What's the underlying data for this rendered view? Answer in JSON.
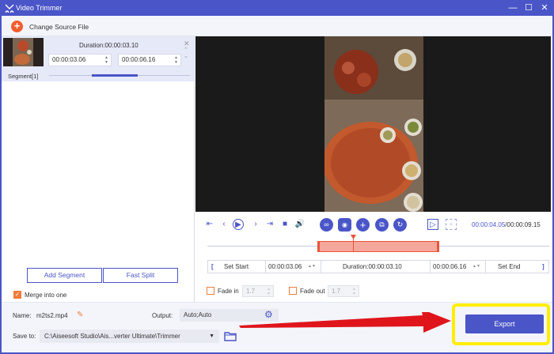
{
  "window": {
    "title": "Video Trimmer",
    "controls": [
      "minimize-icon",
      "maximize-icon",
      "close-icon"
    ]
  },
  "toolbar": {
    "change_source": "Change Source File"
  },
  "segment": {
    "duration_label": "Duration:00:00:03.10",
    "start": "00:00:03.06",
    "end": "00:00:06.16",
    "label": "Segment[1]"
  },
  "left_buttons": {
    "add_segment": "Add Segment",
    "fast_split": "Fast Split"
  },
  "merge": {
    "label": "Merge into one",
    "checked": true
  },
  "player": {
    "current_time": "00:00:04.05",
    "total_time": "/00:00:09.15"
  },
  "trim": {
    "set_start": "Set Start",
    "start_value": "00:00:03.06",
    "duration": "Duration:00:00:03.10",
    "end_value": "00:00:06.16",
    "set_end": "Set End"
  },
  "fade": {
    "fade_in_label": "Fade in",
    "fade_in_value": "1.7",
    "fade_out_label": "Fade out",
    "fade_out_value": "1.7"
  },
  "output": {
    "name_label": "Name:",
    "name_value": "m2ts2.mp4",
    "output_label": "Output:",
    "output_value": "Auto;Auto",
    "save_label": "Save to:",
    "save_path": "C:\\Aiseesoft Studio\\Ais...verter Ultimate\\Trimmer",
    "export": "Export"
  },
  "colors": {
    "accent": "#4a55c8",
    "orange": "#f25d2e",
    "highlight": "#ffee00",
    "arrow": "#e0151c"
  }
}
